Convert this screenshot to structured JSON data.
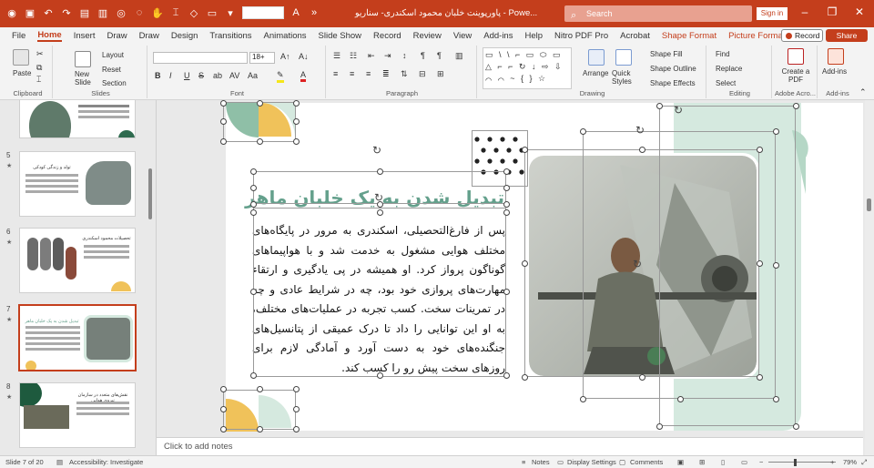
{
  "titlebar": {
    "doc_title": "پاورپوینت خلبان محمود اسکندری- سناریو  -  Powe...",
    "search_placeholder": "Search",
    "signin_label": "Sign in",
    "accent": "#c43e1c"
  },
  "menu": {
    "tabs": [
      "File",
      "Home",
      "Insert",
      "Draw",
      "Draw",
      "Design",
      "Transitions",
      "Animations",
      "Slide Show",
      "Record",
      "Review",
      "View",
      "Add-ins",
      "Help",
      "Nitro PDF Pro",
      "Acrobat",
      "Shape Format",
      "Picture Format"
    ],
    "active": "Home",
    "record_label": "Record",
    "share_label": "Share"
  },
  "ribbon": {
    "clipboard": {
      "label": "Clipboard",
      "paste": "Paste"
    },
    "slides": {
      "label": "Slides",
      "new_slide": "New Slide",
      "layout": "Layout",
      "reset": "Reset",
      "section": "Section"
    },
    "font": {
      "label": "Font",
      "size": "18+",
      "bold": "B",
      "italic": "I",
      "underline": "U",
      "strike": "S",
      "abc": "ab",
      "spacing": "AV",
      "case": "Aa"
    },
    "paragraph": {
      "label": "Paragraph"
    },
    "drawing": {
      "label": "Drawing",
      "arrange": "Arrange",
      "quick_styles": "Quick Styles",
      "shape_fill": "Shape Fill",
      "shape_outline": "Shape Outline",
      "shape_effects": "Shape Effects",
      "shapes_glyphs": "▭ \\ \\ ⌐ ▭ ⬭ ▭ △ ⌐ ⌐ ↻ ↓ ⇨ ⇩ ⌒ ⌒ ~ { } ☆"
    },
    "editing": {
      "label": "Editing",
      "find": "Find",
      "replace": "Replace",
      "select": "Select"
    },
    "adobe": {
      "label": "Adobe Acro...",
      "create_pdf": "Create a PDF"
    },
    "addins": {
      "label": "Add-ins",
      "addins": "Add-ins"
    }
  },
  "thumbs": [
    {
      "num": "",
      "title": ""
    },
    {
      "num": "5",
      "title": "تولد و زندگی کودکی"
    },
    {
      "num": "6",
      "title": "تحصیلات محمود اسکندری"
    },
    {
      "num": "7",
      "title": "تبدیل شدن به یک خلبان ماهر"
    },
    {
      "num": "8",
      "title": "نقش‌های متعدد در سازمان نیروی هوایی"
    }
  ],
  "slide": {
    "title": "تبدیل شدن به یک خلبان ماهر",
    "body": "پس از فارغ‌التحصیلی، اسکندری به مرور در پایگاه‌های مختلف هوایی مشغول به خدمت شد و با هواپیماهای گوناگون پرواز کرد. او همیشه در پی یادگیری و ارتقاء مهارت‌های پروازی خود بود، چه در شرایط عادی و چه در تمرینات سخت. کسب تجربه در عملیات‌های مختلف، به او این توانایی را داد تا درک عمیقی از پتانسیل‌های جنگنده‌های خود به دست آورد و آمادگی لازم برای روزهای سخت پیش رو را کسب کند.",
    "colors": {
      "green": "#8fbfa7",
      "mint": "#d5e9df",
      "gold": "#f0c25a",
      "title": "#64a08c"
    }
  },
  "notes": {
    "placeholder": "Click to add notes"
  },
  "status": {
    "slide_of": "Slide 7 of 20",
    "accessibility": "Accessibility: Investigate",
    "notes": "Notes",
    "display": "Display Settings",
    "comments": "Comments",
    "zoom": "79%"
  }
}
